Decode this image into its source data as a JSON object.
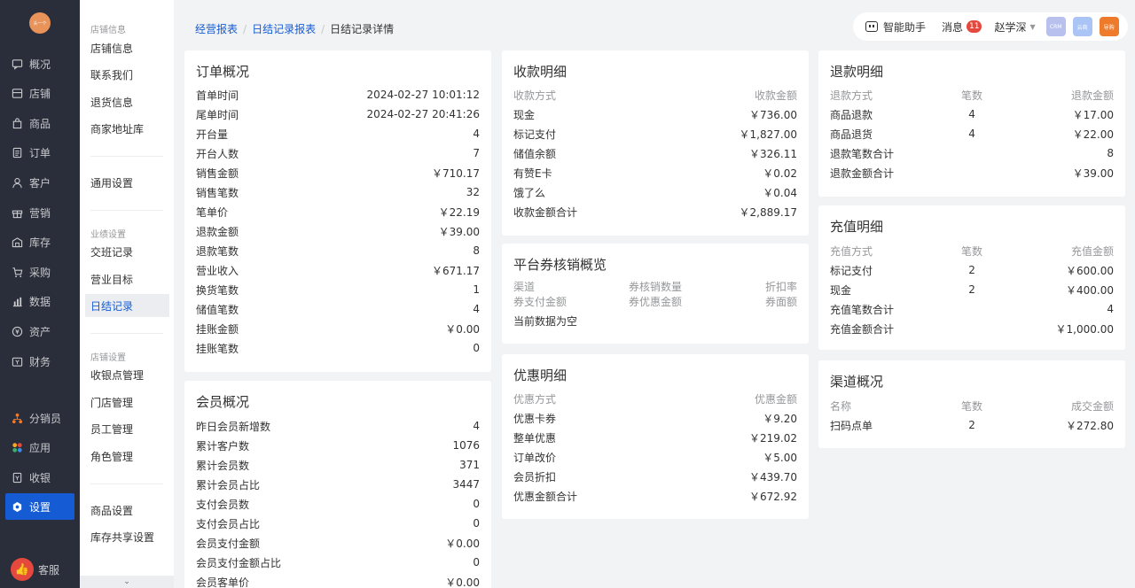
{
  "sidebar": {
    "logo": "头一个",
    "items": [
      "概况",
      "店铺",
      "商品",
      "订单",
      "客户",
      "营销",
      "库存",
      "采购",
      "数据",
      "资产",
      "财务"
    ],
    "items2": [
      "分销员",
      "应用",
      "收银",
      "设置"
    ],
    "service": "客服"
  },
  "subnav": {
    "group1": "店铺信息",
    "g1items": [
      "店铺信息",
      "联系我们",
      "退货信息",
      "商家地址库"
    ],
    "general": "通用设置",
    "group2": "业绩设置",
    "g2items": [
      "交班记录",
      "营业目标",
      "日结记录"
    ],
    "group3": "店铺设置",
    "g3items": [
      "收银点管理",
      "门店管理",
      "员工管理",
      "角色管理"
    ],
    "product": "商品设置",
    "stock": "库存共享设置",
    "more": "⌄"
  },
  "breadcrumb": {
    "l1": "经营报表",
    "l2": "日结记录报表",
    "current": "日结记录详情",
    "sep": "/"
  },
  "topbar": {
    "assistant": "智能助手",
    "messages": "消息",
    "count": "11",
    "user": "赵学深",
    "crm": "CRM",
    "yun": "云商",
    "seg": "导购"
  },
  "order": {
    "title": "订单概况",
    "rows": [
      [
        "首单时间",
        "2024-02-27 10:01:12"
      ],
      [
        "尾单时间",
        "2024-02-27 20:41:26"
      ],
      [
        "开台量",
        "4"
      ],
      [
        "开台人数",
        "7"
      ],
      [
        "销售金额",
        "￥710.17"
      ],
      [
        "销售笔数",
        "32"
      ],
      [
        "笔单价",
        "￥22.19"
      ],
      [
        "退款金额",
        "￥39.00"
      ],
      [
        "退款笔数",
        "8"
      ],
      [
        "营业收入",
        "￥671.17"
      ],
      [
        "换货笔数",
        "1"
      ],
      [
        "储值笔数",
        "4"
      ],
      [
        "挂账金额",
        "￥0.00"
      ],
      [
        "挂账笔数",
        "0"
      ]
    ]
  },
  "member": {
    "title": "会员概况",
    "rows": [
      [
        "昨日会员新增数",
        "4"
      ],
      [
        "累计客户数",
        "1076"
      ],
      [
        "累计会员数",
        "371"
      ],
      [
        "累计会员占比",
        "3447"
      ],
      [
        "支付会员数",
        "0"
      ],
      [
        "支付会员占比",
        "0"
      ],
      [
        "会员支付金额",
        "￥0.00"
      ],
      [
        "会员支付金额占比",
        "0"
      ],
      [
        "会员客单价",
        "￥0.00"
      ]
    ]
  },
  "receipt": {
    "title": "收款明细",
    "head": [
      "收款方式",
      "收款金额"
    ],
    "rows": [
      [
        "现金",
        "￥736.00"
      ],
      [
        "标记支付",
        "￥1,827.00"
      ],
      [
        "储值余额",
        "￥326.11"
      ],
      [
        "有赞E卡",
        "￥0.02"
      ],
      [
        "饿了么",
        "￥0.04"
      ],
      [
        "收款金额合计",
        "￥2,889.17"
      ]
    ]
  },
  "coupon": {
    "title": "平台券核销概览",
    "h1": [
      "渠道",
      "券核销数量",
      "折扣率"
    ],
    "h2": [
      "券支付金额",
      "券优惠金额",
      "券面额"
    ],
    "empty": "当前数据为空"
  },
  "discount": {
    "title": "优惠明细",
    "head": [
      "优惠方式",
      "优惠金额"
    ],
    "rows": [
      [
        "优惠卡券",
        "￥9.20"
      ],
      [
        "整单优惠",
        "￥219.02"
      ],
      [
        "订单改价",
        "￥5.00"
      ],
      [
        "会员折扣",
        "￥439.70"
      ],
      [
        "优惠金额合计",
        "￥672.92"
      ]
    ]
  },
  "refund": {
    "title": "退款明细",
    "head": [
      "退款方式",
      "笔数",
      "退款金额"
    ],
    "rows": [
      [
        "商品退款",
        "4",
        "￥17.00"
      ],
      [
        "商品退货",
        "4",
        "￥22.00"
      ]
    ],
    "totals": [
      [
        "退款笔数合计",
        "8"
      ],
      [
        "退款金额合计",
        "￥39.00"
      ]
    ]
  },
  "recharge": {
    "title": "充值明细",
    "head": [
      "充值方式",
      "笔数",
      "充值金额"
    ],
    "rows": [
      [
        "标记支付",
        "2",
        "￥600.00"
      ],
      [
        "现金",
        "2",
        "￥400.00"
      ]
    ],
    "totals": [
      [
        "充值笔数合计",
        "4"
      ],
      [
        "充值金额合计",
        "￥1,000.00"
      ]
    ]
  },
  "channel": {
    "title": "渠道概况",
    "head": [
      "名称",
      "笔数",
      "成交金额"
    ],
    "rows": [
      [
        "扫码点单",
        "2",
        "￥272.80"
      ]
    ]
  }
}
